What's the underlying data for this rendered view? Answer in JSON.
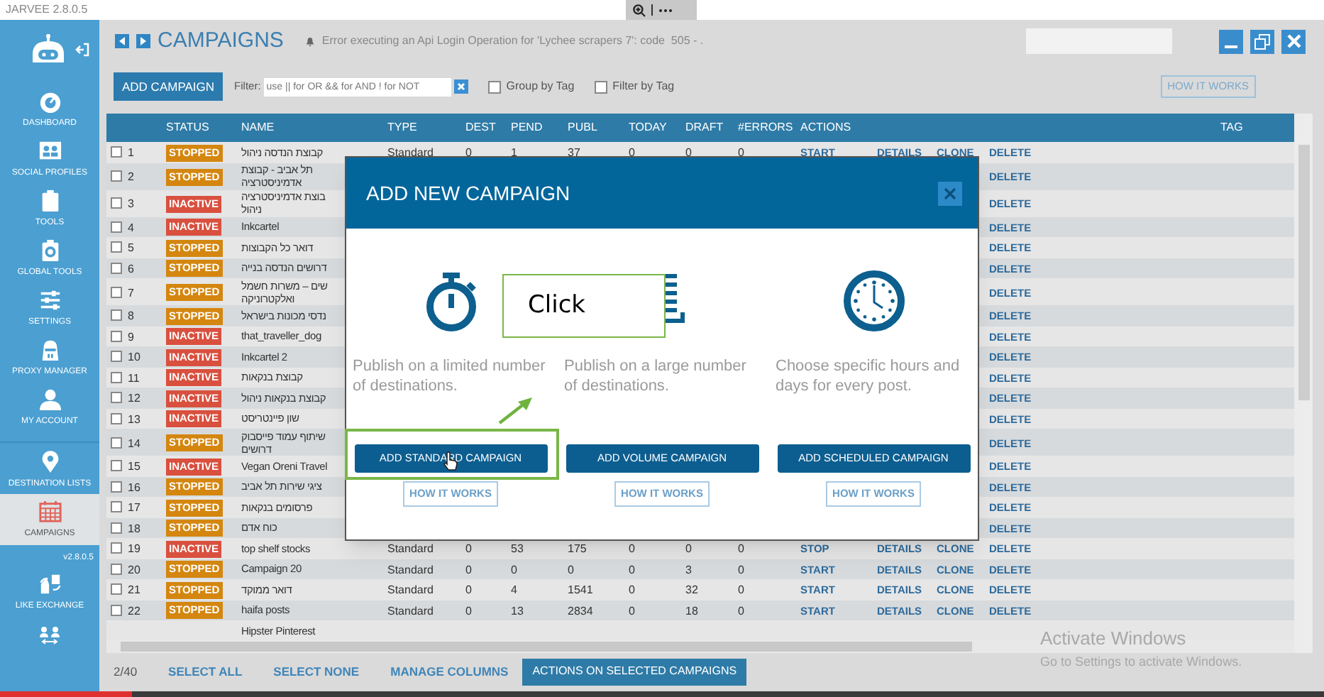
{
  "app_title": "JARVEE 2.8.0.5",
  "video_progress": {
    "level": 0.1
  },
  "sidebar": {
    "items": [
      {
        "kind": "nav",
        "label": "DASHBOARD",
        "selected": false
      },
      {
        "kind": "nav",
        "label": "SOCIAL PROFILES",
        "selected": false
      },
      {
        "kind": "nav",
        "label": "TOOLS",
        "selected": false
      },
      {
        "kind": "nav",
        "label": "GLOBAL TOOLS",
        "selected": false
      },
      {
        "kind": "nav",
        "label": "SETTINGS",
        "selected": false
      },
      {
        "kind": "nav",
        "label": "PROXY MANAGER",
        "selected": false
      },
      {
        "kind": "nav",
        "label": "MY ACCOUNT",
        "selected": false
      },
      {
        "kind": "nav",
        "label": "DESTINATION LISTS",
        "selected": false
      },
      {
        "kind": "nav",
        "label": "CAMPAIGNS",
        "selected": true
      },
      {
        "kind": "version",
        "label": "v2.8.0.5"
      },
      {
        "kind": "nav",
        "label": "LIKE EXCHANGE",
        "selected": false
      }
    ]
  },
  "header": {
    "title": "CAMPAIGNS",
    "alert": "Error executing an Api Login Operation for 'Lychee scrapers 7': code  505 - ."
  },
  "toolbar": {
    "add_button": "ADD CAMPAIGN",
    "filter_label": "Filter:",
    "filter_placeholder": "use || for OR && for AND ! for NOT",
    "checkboxes": [
      {
        "label": "Group by Tag",
        "checked": false
      },
      {
        "label": "Filter by Tag",
        "checked": false
      }
    ],
    "help_button": "HOW IT WORKS"
  },
  "table": {
    "columns": [
      "STATUS",
      "NAME",
      "TYPE",
      "DEST",
      "PEND",
      "PUBL",
      "TODAY",
      "DRAFT",
      "#ERRORS",
      "ACTIONS",
      "TAG"
    ],
    "rows": [
      {
        "num": "1",
        "checked": false,
        "status": {
          "kind": "stopped",
          "label": "STOPPED"
        },
        "name": "קבוצת הנדסה ניהול",
        "values": [
          "Standard",
          "0",
          "1",
          "37",
          "0",
          "0",
          "0"
        ],
        "actions": {
          "toggle": "START",
          "details": "DETAILS",
          "clone": "CLONE",
          "delete": "DELETE"
        }
      },
      {
        "num": "2",
        "checked": false,
        "status": {
          "kind": "stopped",
          "label": "STOPPED"
        },
        "name": "תל אביב - קבוצת אדמיניסטרציה",
        "actions": {
          "delete": "DELETE"
        }
      },
      {
        "num": "3",
        "checked": false,
        "status": {
          "kind": "inactive",
          "label": "INACTIVE"
        },
        "name": "בוצת אדמיניסטרציה ניהול",
        "actions": {
          "delete": "DELETE"
        }
      },
      {
        "num": "4",
        "checked": false,
        "status": {
          "kind": "inactive",
          "label": "INACTIVE"
        },
        "name": "Inkcartel",
        "actions": {
          "delete": "DELETE"
        }
      },
      {
        "num": "5",
        "checked": false,
        "status": {
          "kind": "stopped",
          "label": "STOPPED"
        },
        "name": "דואר כל הקבוצות",
        "actions": {
          "delete": "DELETE"
        }
      },
      {
        "num": "6",
        "checked": false,
        "status": {
          "kind": "stopped",
          "label": "STOPPED"
        },
        "name": "דרושים הנדסה בנייה",
        "actions": {
          "delete": "DELETE"
        }
      },
      {
        "num": "7",
        "checked": false,
        "status": {
          "kind": "stopped",
          "label": "STOPPED"
        },
        "name": "שים – משרות חשמל ואלקטרוניקה",
        "actions": {
          "delete": "DELETE"
        }
      },
      {
        "num": "8",
        "checked": false,
        "status": {
          "kind": "stopped",
          "label": "STOPPED"
        },
        "name": "נדסי מכונות בישראל",
        "actions": {
          "delete": "DELETE"
        }
      },
      {
        "num": "9",
        "checked": false,
        "status": {
          "kind": "inactive",
          "label": "INACTIVE"
        },
        "name": "that_traveller_dog",
        "actions": {
          "delete": "DELETE"
        }
      },
      {
        "num": "10",
        "checked": false,
        "status": {
          "kind": "inactive",
          "label": "INACTIVE"
        },
        "name": "Inkcartel 2",
        "actions": {
          "delete": "DELETE"
        }
      },
      {
        "num": "11",
        "checked": false,
        "status": {
          "kind": "inactive",
          "label": "INACTIVE"
        },
        "name": "קבוצת בנקאות",
        "actions": {
          "delete": "DELETE"
        }
      },
      {
        "num": "12",
        "checked": false,
        "status": {
          "kind": "inactive",
          "label": "INACTIVE"
        },
        "name": "קבוצת בנקאות ניהול",
        "actions": {
          "delete": "DELETE"
        }
      },
      {
        "num": "13",
        "checked": false,
        "status": {
          "kind": "inactive",
          "label": "INACTIVE"
        },
        "name": "שון פיינטריסט",
        "actions": {
          "delete": "DELETE"
        }
      },
      {
        "num": "14",
        "checked": false,
        "status": {
          "kind": "stopped",
          "label": "STOPPED"
        },
        "name": "שיתוף עמוד פייסבוק דרושים",
        "actions": {
          "delete": "DELETE"
        }
      },
      {
        "num": "15",
        "checked": false,
        "status": {
          "kind": "inactive",
          "label": "INACTIVE"
        },
        "name": "Vegan Oreni Travel",
        "actions": {
          "delete": "DELETE"
        }
      },
      {
        "num": "16",
        "checked": false,
        "status": {
          "kind": "stopped",
          "label": "STOPPED"
        },
        "name": "ציגי שירות תל אביב",
        "actions": {
          "delete": "DELETE"
        }
      },
      {
        "num": "17",
        "checked": false,
        "status": {
          "kind": "stopped",
          "label": "STOPPED"
        },
        "name": "פרסומים בנקאות",
        "actions": {
          "delete": "DELETE"
        }
      },
      {
        "num": "18",
        "checked": false,
        "status": {
          "kind": "stopped",
          "label": "STOPPED"
        },
        "name": "כוח אדם",
        "actions": {
          "delete": "DELETE"
        }
      },
      {
        "num": "19",
        "checked": false,
        "status": {
          "kind": "inactive",
          "label": "INACTIVE"
        },
        "name": "top shelf stocks",
        "values": [
          "Standard",
          "0",
          "53",
          "175",
          "0",
          "0",
          "0"
        ],
        "actions": {
          "toggle": "STOP",
          "details": "DETAILS",
          "clone": "CLONE",
          "delete": "DELETE"
        }
      },
      {
        "num": "20",
        "checked": false,
        "status": {
          "kind": "stopped",
          "label": "STOPPED"
        },
        "name": "Campaign 20",
        "values": [
          "Standard",
          "0",
          "0",
          "0",
          "0",
          "3",
          "0"
        ],
        "actions": {
          "toggle": "START",
          "details": "DETAILS",
          "clone": "CLONE",
          "delete": "DELETE"
        }
      },
      {
        "num": "21",
        "checked": false,
        "status": {
          "kind": "stopped",
          "label": "STOPPED"
        },
        "name": "דואר ממוקד",
        "values": [
          "Standard",
          "0",
          "4",
          "1541",
          "0",
          "32",
          "0"
        ],
        "actions": {
          "toggle": "START",
          "details": "DETAILS",
          "clone": "CLONE",
          "delete": "DELETE"
        }
      },
      {
        "num": "22",
        "checked": false,
        "status": {
          "kind": "stopped",
          "label": "STOPPED"
        },
        "name": "haifa posts",
        "values": [
          "Standard",
          "0",
          "13",
          "2834",
          "0",
          "18",
          "0"
        ],
        "actions": {
          "toggle": "START",
          "details": "DETAILS",
          "clone": "CLONE",
          "delete": "DELETE"
        }
      },
      {
        "name": "Hipster Pinterest"
      }
    ]
  },
  "footer": {
    "count": "2/40",
    "links": [
      "SELECT ALL",
      "SELECT NONE",
      "MANAGE COLUMNS"
    ],
    "actions_button": "ACTIONS ON SELECTED CAMPAIGNS"
  },
  "modal": {
    "title": "ADD NEW CAMPAIGN",
    "options": [
      {
        "kind": "standard",
        "description": "Publish on a limited number of destinations.",
        "button": "ADD STANDARD CAMPAIGN",
        "help": "HOW IT WORKS"
      },
      {
        "kind": "volume",
        "description": "Publish on a large number of destinations.",
        "button": "ADD VOLUME CAMPAIGN",
        "help": "HOW IT WORKS"
      },
      {
        "kind": "scheduled",
        "description": "Choose specific hours and days for every post.",
        "button": "ADD SCHEDULED CAMPAIGN",
        "help": "HOW IT WORKS"
      }
    ]
  },
  "annotation": {
    "callout": "Click"
  },
  "os_notice": {
    "title": "Activate Windows",
    "subtitle": "Go to Settings to activate Windows."
  }
}
